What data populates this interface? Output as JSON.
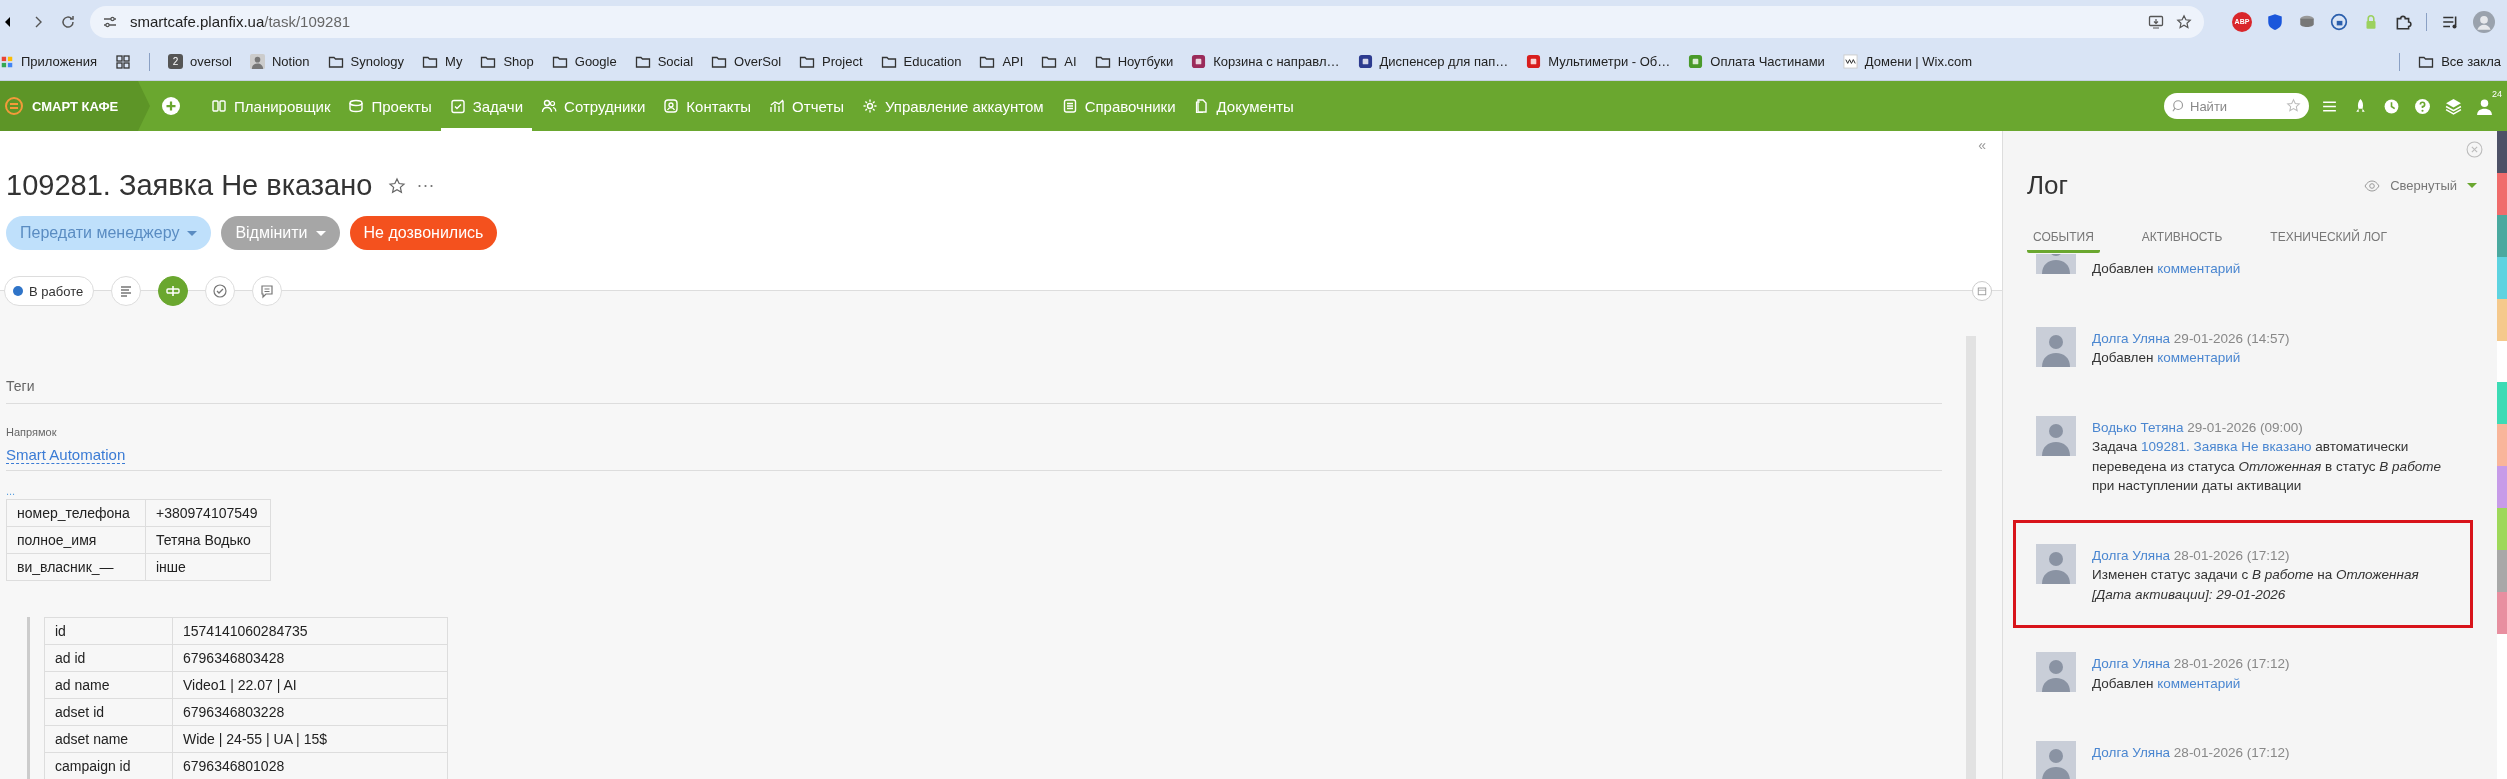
{
  "browser": {
    "url_host": "smartcafe.planfix.ua",
    "url_path": "/task/109281",
    "extension_badge": "ABP",
    "bookmarks": [
      {
        "label": "Приложения",
        "kind": "apps"
      },
      {
        "label": "oversol",
        "kind": "badge",
        "badge": "2"
      },
      {
        "label": "Notion",
        "kind": "person"
      },
      {
        "label": "Synology",
        "kind": "folder"
      },
      {
        "label": "My",
        "kind": "folder"
      },
      {
        "label": "Shop",
        "kind": "folder"
      },
      {
        "label": "Google",
        "kind": "folder"
      },
      {
        "label": "Social",
        "kind": "folder"
      },
      {
        "label": "OverSol",
        "kind": "folder"
      },
      {
        "label": "Project",
        "kind": "folder"
      },
      {
        "label": "Education",
        "kind": "folder"
      },
      {
        "label": "API",
        "kind": "folder"
      },
      {
        "label": "AI",
        "kind": "folder"
      },
      {
        "label": "Ноутбуки",
        "kind": "folder"
      },
      {
        "label": "Корзина с направл…",
        "kind": "site",
        "color": "#9b2b5a"
      },
      {
        "label": "Диспенсер для пап…",
        "kind": "site",
        "color": "#2d3b8f"
      },
      {
        "label": "Мультиметри - Об…",
        "kind": "site",
        "color": "#d81e1e"
      },
      {
        "label": "Оплата Частинами",
        "kind": "site",
        "color": "#4a9a2a"
      },
      {
        "label": "Домени | Wix.com",
        "kind": "wix"
      }
    ],
    "all_bookmarks": "Все закла"
  },
  "nav": {
    "logo": "СМАРТ КАФЕ",
    "items": [
      {
        "label": "Планировщик",
        "selected": false
      },
      {
        "label": "Проекты",
        "selected": false
      },
      {
        "label": "Задачи",
        "selected": true
      },
      {
        "label": "Сотрудники",
        "selected": false
      },
      {
        "label": "Контакты",
        "selected": false
      },
      {
        "label": "Отчеты",
        "selected": false
      },
      {
        "label": "Управление аккаунтом",
        "selected": false
      },
      {
        "label": "Справочники",
        "selected": false
      },
      {
        "label": "Документы",
        "selected": false
      }
    ],
    "search": {
      "placeholder": "Найти"
    },
    "user_badge": "24"
  },
  "task": {
    "collapse": "«",
    "title": "109281. Заявка Не вказано",
    "more": "···",
    "buttons": [
      {
        "label": "Передати менеджеру",
        "kind": "light",
        "dropdown": true
      },
      {
        "label": "Відмінити",
        "kind": "grey",
        "dropdown": true
      },
      {
        "label": "Не дозвонились",
        "kind": "orange",
        "dropdown": false
      }
    ],
    "status": {
      "label": "В работе",
      "color": "#2f74c8"
    },
    "tools": [
      {
        "selected": false
      },
      {
        "selected": true
      },
      {
        "selected": false
      },
      {
        "selected": false
      }
    ],
    "tags_label": "Теги",
    "direction": {
      "label": "Напрямок",
      "value": "Smart Automation"
    },
    "more_link": "...",
    "table_1": [
      [
        "номер_телефона",
        "+380974107549"
      ],
      [
        "полное_имя",
        "Тетяна Водько"
      ],
      [
        "ви_власник_—",
        "інше"
      ]
    ],
    "table_2": [
      [
        "id",
        "1574141060284735"
      ],
      [
        "ad id",
        "6796346803428"
      ],
      [
        "ad name",
        "Video1 | 22.07 | AI"
      ],
      [
        "adset id",
        "6796346803228"
      ],
      [
        "adset name",
        "Wide | 24-55 | UA | 15$"
      ],
      [
        "campaign id",
        "6796346801028"
      ]
    ]
  },
  "log": {
    "title": "Лог",
    "view": "Свернутый",
    "tabs": [
      {
        "label": "СОБЫТИЯ",
        "selected": true
      },
      {
        "label": "АКТИВНОСТЬ",
        "selected": false
      },
      {
        "label": "ТЕХНИЧЕСКИЙ ЛОГ",
        "selected": false
      }
    ],
    "entries": [
      {
        "highlighted": false,
        "text": [
          {
            "kind": "plain",
            "text": "Добавлен "
          },
          {
            "kind": "link",
            "text": "комментарий"
          }
        ]
      },
      {
        "author": "Долга Уляна",
        "date": "29-01-2026 (14:57)",
        "highlighted": false,
        "text": [
          {
            "kind": "plain",
            "text": "Добавлен "
          },
          {
            "kind": "link",
            "text": "комментарий"
          }
        ]
      },
      {
        "author": "Водько Тетяна",
        "date": "29-01-2026 (09:00)",
        "highlighted": false,
        "text": [
          {
            "kind": "plain",
            "text": "Задача "
          },
          {
            "kind": "link",
            "text": "109281. Заявка Не вказано"
          },
          {
            "kind": "plain",
            "text": " автоматически переведена из статуса "
          },
          {
            "kind": "italic",
            "text": "Отложенная"
          },
          {
            "kind": "plain",
            "text": " в статус "
          },
          {
            "kind": "italic",
            "text": "В работе"
          },
          {
            "kind": "plain",
            "text": " при наступлении даты активации"
          }
        ]
      },
      {
        "author": "Долга Уляна",
        "date": "28-01-2026 (17:12)",
        "highlighted": true,
        "text": [
          {
            "kind": "plain",
            "text": "Изменен статус задачи  с "
          },
          {
            "kind": "italic",
            "text": "В работе"
          },
          {
            "kind": "plain",
            "text": " на "
          },
          {
            "kind": "italic",
            "text": "Отложенная [Дата активации]: 29-01-2026"
          }
        ]
      },
      {
        "author": "Долга Уляна",
        "date": "28-01-2026 (17:12)",
        "highlighted": false,
        "text": [
          {
            "kind": "plain",
            "text": "Добавлен "
          },
          {
            "kind": "link",
            "text": "комментарий"
          }
        ]
      },
      {
        "author": "Долга Уляна",
        "date": "28-01-2026 (17:12)",
        "highlighted": false
      }
    ]
  },
  "stripe_groups": [
    {
      "stripes": [
        {
          "color": "#4d5166"
        },
        {
          "color": "#f06c6c"
        },
        {
          "color": "#4aa99f"
        },
        {
          "color": "#5ed3e0"
        },
        {
          "color": "#f5c98c"
        }
      ]
    },
    {
      "stripes": [
        {
          "color": "#3ddbb5"
        },
        {
          "color": "#f9b59a"
        },
        {
          "color": "#c79be8"
        },
        {
          "color": "#9ed85a"
        },
        {
          "color": "#a8a8a8"
        },
        {
          "color": "#e88fa0"
        }
      ]
    }
  ]
}
